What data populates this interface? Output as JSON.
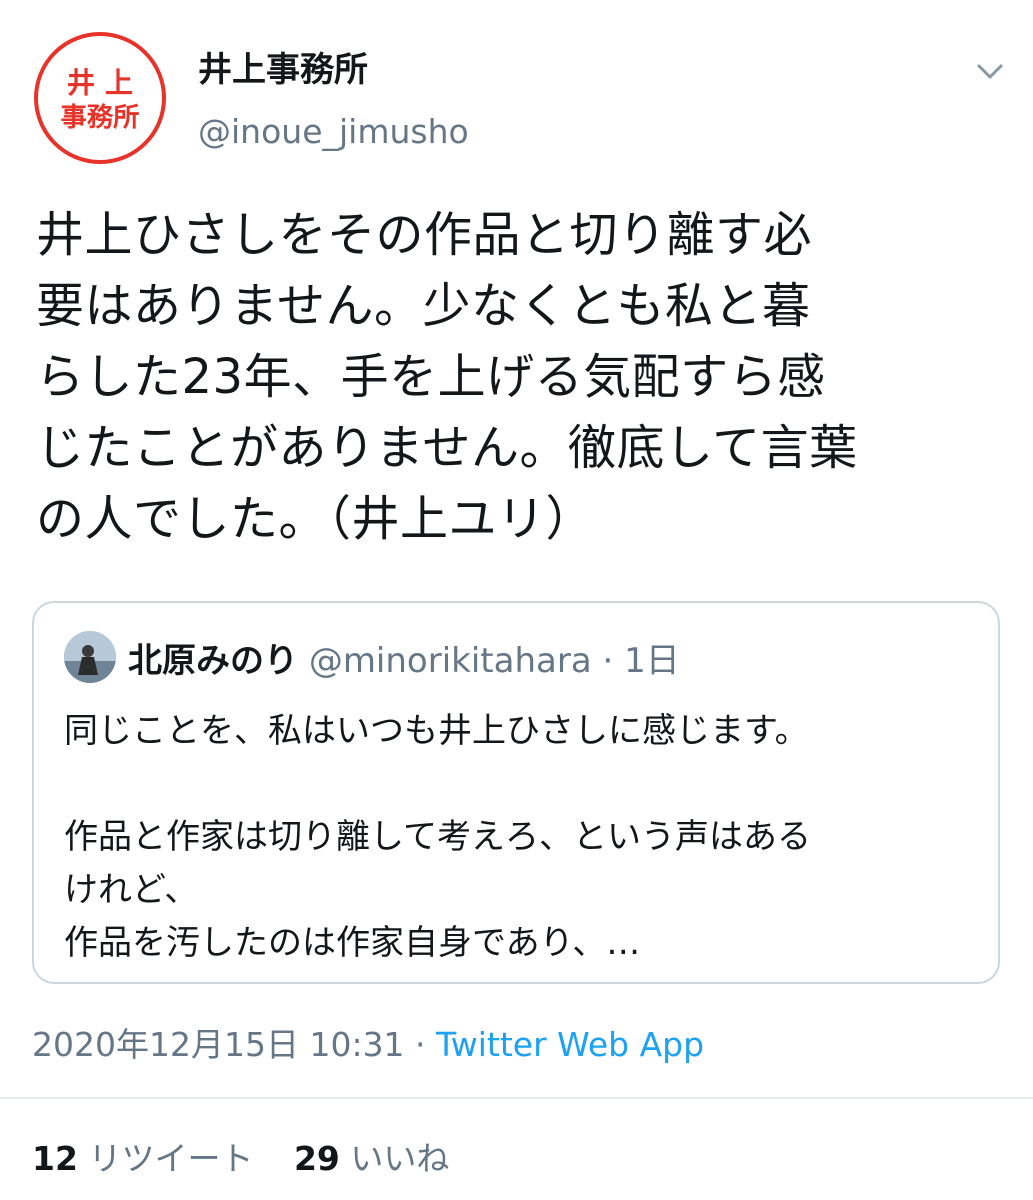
{
  "author": {
    "display_name": "井上事務所",
    "handle": "@inoue_jimusho",
    "avatar_text_top": "井 上",
    "avatar_text_bottom": "事務所",
    "avatar_color": "#e8332a"
  },
  "tweet": {
    "lines": [
      "井上ひさしをその作品と切り離す必",
      "要はありません。少なくとも私と暮",
      "らした23年、手を上げる気配すら感",
      "じたことがありません。徹底して言葉",
      "の人でした。（井上ユリ）"
    ]
  },
  "quoted": {
    "name": "北原みのり",
    "handle": "@minorikitahara",
    "dot": "·",
    "time": "1日",
    "lines": [
      "同じことを、私はいつも井上ひさしに感じます。",
      "",
      "作品と作家は切り離して考えろ、という声はある",
      "けれど、",
      "作品を汚したのは作家自身であり、…"
    ]
  },
  "meta": {
    "date": "2020年12月15日 10:31",
    "sep": " · ",
    "source": "Twitter Web App"
  },
  "stats": {
    "retweet_count": "12",
    "retweet_label": "リツイート",
    "like_count": "29",
    "like_label": "いいね"
  },
  "colors": {
    "link": "#1da1f2",
    "secondary": "#657786",
    "border": "#ccd6dd"
  },
  "icons": {
    "menu": "chevron-down-icon"
  }
}
